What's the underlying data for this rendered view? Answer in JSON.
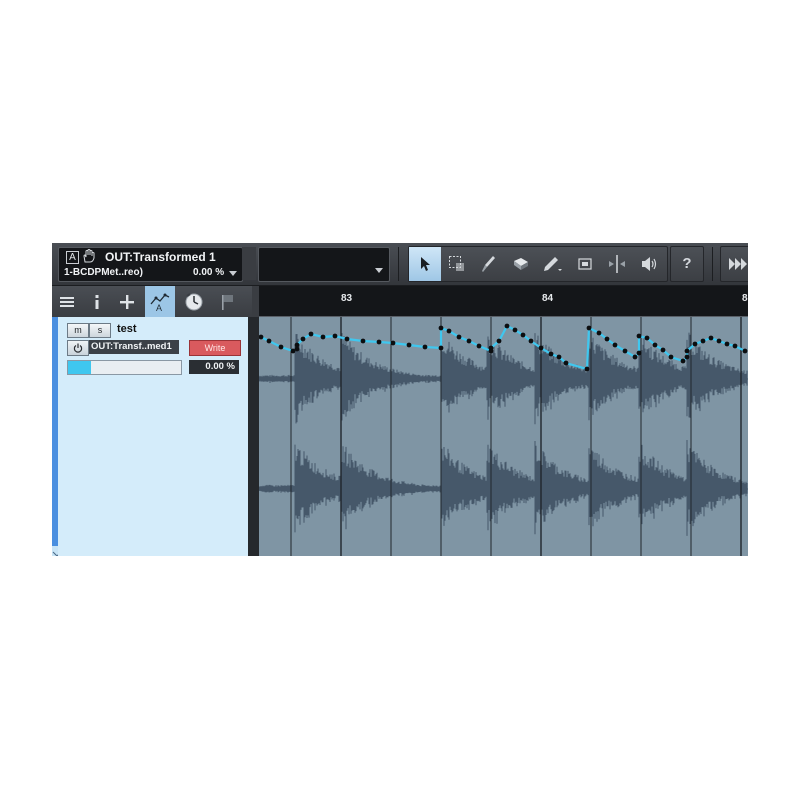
{
  "automation": {
    "a_label": "A",
    "parameter": "OUT:Transformed 1",
    "track": "1-BCDPMet..reo)",
    "value": "0.00 %"
  },
  "toolbar": {
    "tools": [
      {
        "name": "arrow-tool",
        "icon": "arrow-icon",
        "active": true
      },
      {
        "name": "range-tool",
        "icon": "range-icon"
      },
      {
        "name": "split-tool",
        "icon": "knife-icon"
      },
      {
        "name": "eraser-tool",
        "icon": "eraser-icon"
      },
      {
        "name": "paint-tool",
        "icon": "pencil-icon"
      },
      {
        "name": "mute-tool",
        "icon": "mute-icon"
      },
      {
        "name": "bend-tool",
        "icon": "bend-icon"
      },
      {
        "name": "listen-tool",
        "icon": "speaker-icon"
      }
    ],
    "help_label": "?"
  },
  "track_tools": [
    "list-icon",
    "info-icon",
    "plus-icon",
    "automation-icon",
    "clock-icon",
    "flag-icon"
  ],
  "ruler": {
    "bars": [
      "83",
      "84",
      "8"
    ]
  },
  "track": {
    "mute_label": "m",
    "solo_label": "s",
    "name": "test",
    "param": "OUT:Transf..med1",
    "write_label": "Write",
    "level_value": "0.00 %",
    "level_fraction": 0.2
  },
  "colors": {
    "accent": "#3fc7ef",
    "lane_bg": "#7f95a4",
    "waveform": "#46586a",
    "write": "#d95a5e",
    "header_bg": "#d4ecfa"
  }
}
